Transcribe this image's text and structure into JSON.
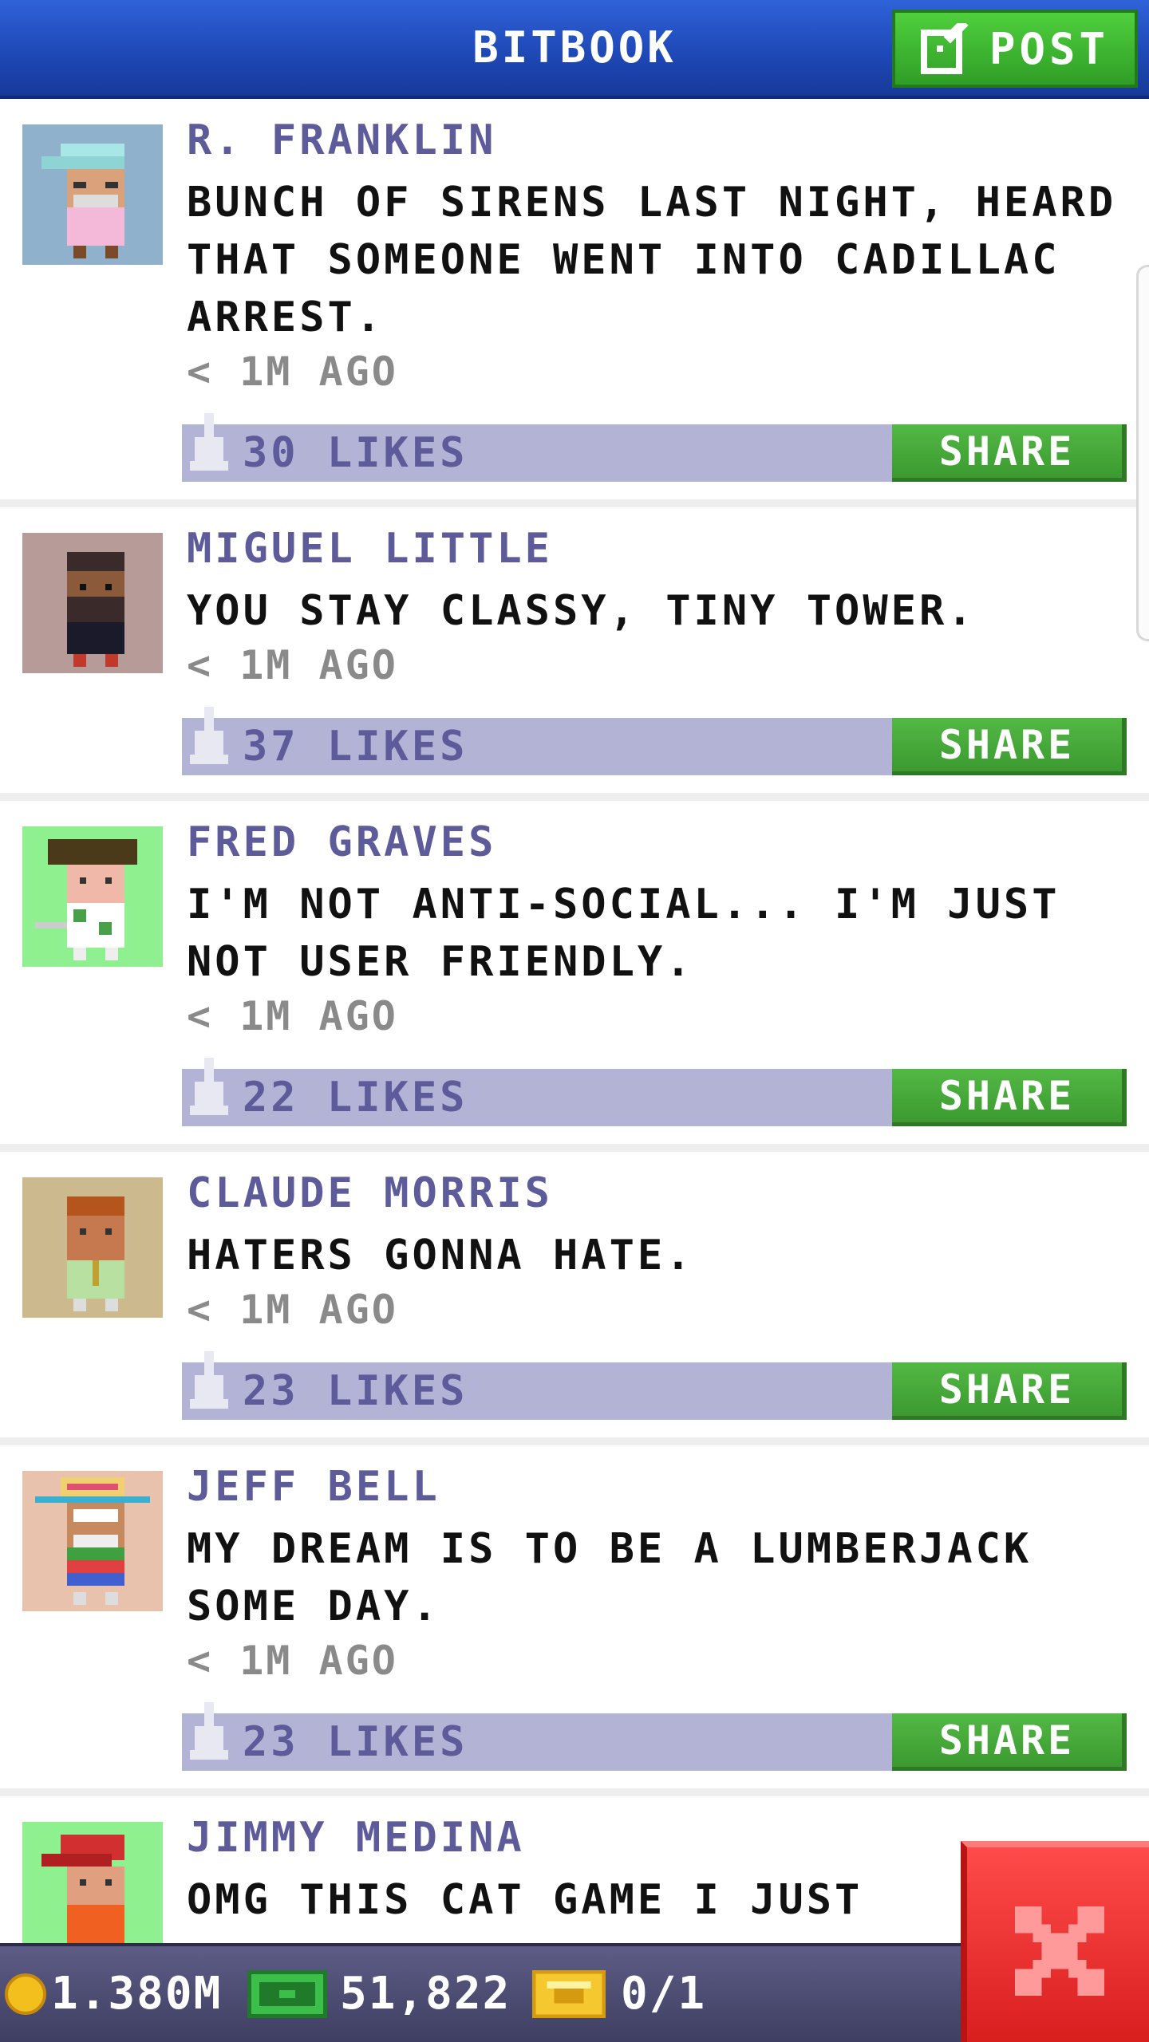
{
  "header": {
    "title": "BITBOOK",
    "post_label": "POST"
  },
  "posts": [
    {
      "name": "R. FRANKLIN",
      "message": "BUNCH OF SIRENS LAST NIGHT, HEARD THAT SOMEONE WENT INTO CADILLAC ARREST.",
      "time": "< 1M AGO",
      "likes": "30 LIKES",
      "share_label": "SHARE",
      "avatar_bg": "#8fb1cc"
    },
    {
      "name": "MIGUEL LITTLE",
      "message": "YOU STAY CLASSY, TINY TOWER.",
      "time": "< 1M AGO",
      "likes": "37 LIKES",
      "share_label": "SHARE",
      "avatar_bg": "#b79b98"
    },
    {
      "name": "FRED GRAVES",
      "message": "I'M NOT ANTI-SOCIAL... I'M JUST NOT USER FRIENDLY.",
      "time": "< 1M AGO",
      "likes": "22 LIKES",
      "share_label": "SHARE",
      "avatar_bg": "#8ef08e"
    },
    {
      "name": "CLAUDE MORRIS",
      "message": "HATERS GONNA HATE.",
      "time": "< 1M AGO",
      "likes": "23 LIKES",
      "share_label": "SHARE",
      "avatar_bg": "#cdb98e"
    },
    {
      "name": "JEFF BELL",
      "message": "MY DREAM IS TO BE A LUMBERJACK SOME DAY.",
      "time": "< 1M AGO",
      "likes": "23 LIKES",
      "share_label": "SHARE",
      "avatar_bg": "#e8c2ad"
    },
    {
      "name": "JIMMY MEDINA",
      "message": "OMG THIS CAT GAME I JUST",
      "time": "",
      "likes": "",
      "share_label": "",
      "avatar_bg": "#8ef08e"
    }
  ],
  "status": {
    "coins": "1.380M",
    "bux": "51,822",
    "vip": "0/1"
  },
  "colors": {
    "header_blue": "#1f49b8",
    "post_green": "#3ab72e",
    "like_bar": "#b3b3d6",
    "name_purple": "#5d5b9a",
    "close_red": "#e12424"
  },
  "icons": {
    "post": "edit-icon",
    "likes": "thumbs-up-icon",
    "coins": "coin-icon",
    "bux": "bux-icon",
    "vip": "vip-ticket-icon",
    "close": "close-icon"
  }
}
